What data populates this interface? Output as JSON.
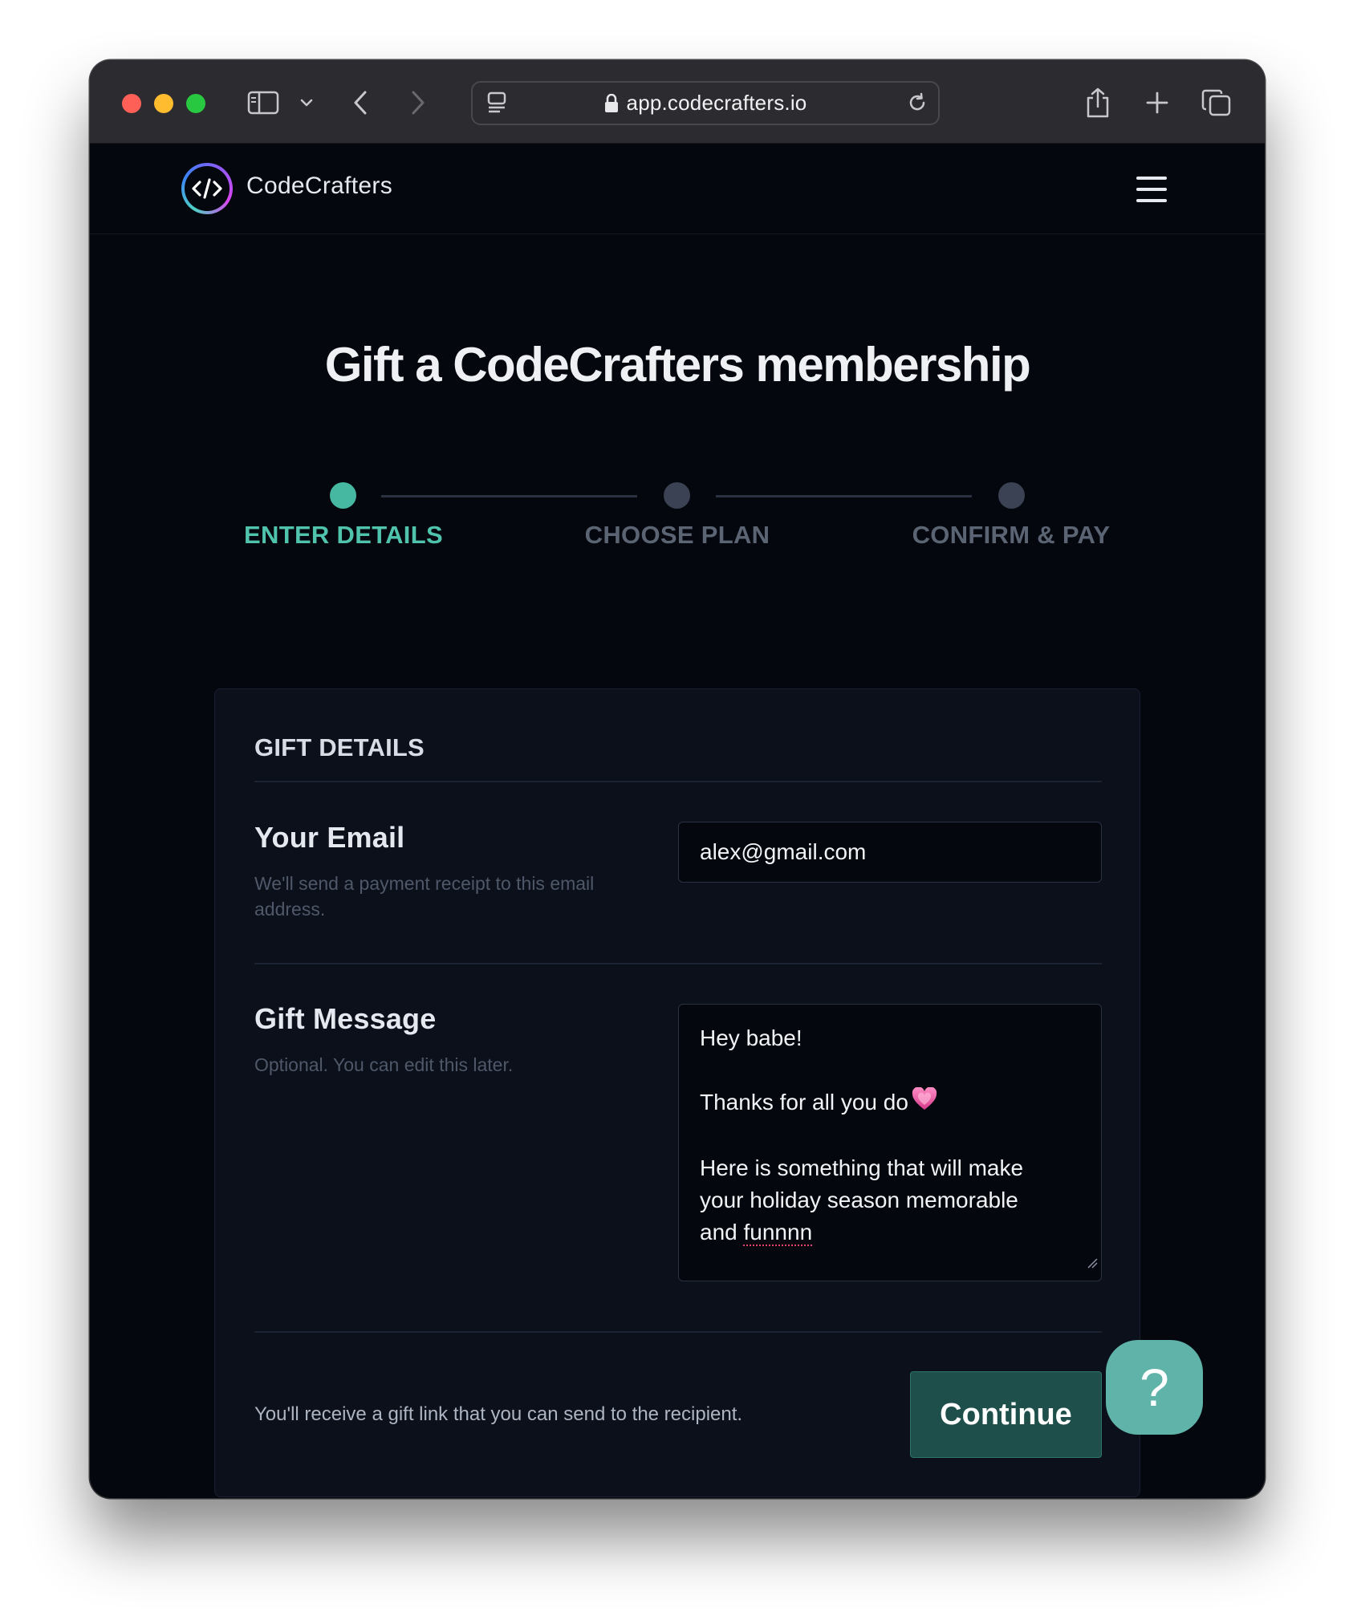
{
  "browser": {
    "url": "app.codecrafters.io",
    "icons": [
      "close-window-icon",
      "minimize-window-icon",
      "maximize-window-icon",
      "sidebar-icon",
      "chevron-down-icon",
      "back-icon",
      "forward-icon",
      "page-menu-icon",
      "lock-icon",
      "reload-icon",
      "share-icon",
      "new-tab-icon",
      "tabs-overview-icon"
    ]
  },
  "header": {
    "brand": "CodeCrafters",
    "icons": [
      "code-logo-icon",
      "hamburger-menu-icon"
    ]
  },
  "page": {
    "title": "Gift a CodeCrafters membership"
  },
  "stepper": {
    "steps": [
      {
        "label": "ENTER DETAILS",
        "active": true
      },
      {
        "label": "CHOOSE PLAN",
        "active": false
      },
      {
        "label": "CONFIRM & PAY",
        "active": false
      }
    ]
  },
  "card": {
    "title": "GIFT DETAILS",
    "email": {
      "label": "Your Email",
      "help": "We'll send a payment receipt to this email address.",
      "value": "alex@gmail.com"
    },
    "message": {
      "label": "Gift Message",
      "help": "Optional. You can edit this later.",
      "lines": {
        "l1": "Hey babe!",
        "l2": "",
        "l3": "Thanks for all you do",
        "l4": "",
        "l5": "Here is something that will make",
        "l6": "your holiday season memorable",
        "l7a": "and ",
        "l7b": "funnnn"
      },
      "emoji": "heart-icon"
    },
    "footer_note": "You'll receive a gift link that you can send to the recipient.",
    "continue_label": "Continue"
  },
  "help_button": {
    "label": "?"
  },
  "colors": {
    "accent": "#4fc3ab",
    "button": "#1f4f4a",
    "help": "#5fb3a8",
    "background": "#05070f"
  }
}
